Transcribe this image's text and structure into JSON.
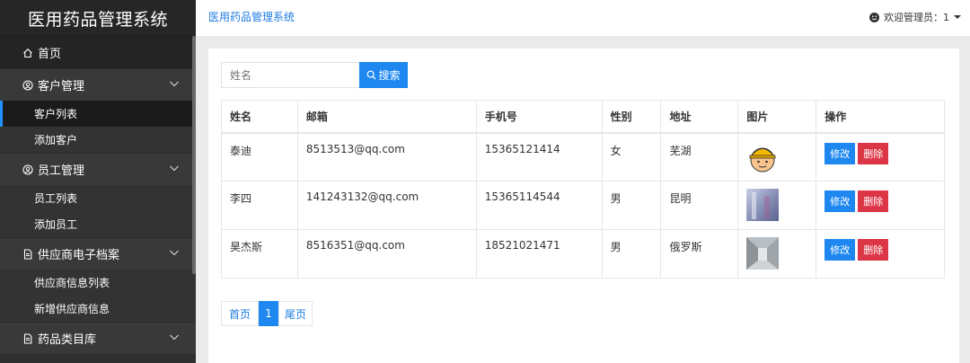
{
  "app": {
    "title": "医用药品管理系统"
  },
  "header": {
    "link": "医用药品管理系统",
    "welcome": "欢迎管理员：1"
  },
  "sidebar": {
    "home": "首页",
    "groups": [
      {
        "label": "客户管理",
        "icon": "user-circle-icon",
        "items": [
          "客户列表",
          "添加客户"
        ]
      },
      {
        "label": "员工管理",
        "icon": "user-circle-icon",
        "items": [
          "员工列表",
          "添加员工"
        ]
      },
      {
        "label": "供应商电子档案",
        "icon": "document-icon",
        "items": [
          "供应商信息列表",
          "新增供应商信息"
        ]
      },
      {
        "label": "药品类目库",
        "icon": "document-icon",
        "items": []
      }
    ],
    "active_item": "客户列表"
  },
  "search": {
    "placeholder": "姓名",
    "button": "搜索"
  },
  "table": {
    "columns": [
      "姓名",
      "邮箱",
      "手机号",
      "性别",
      "地址",
      "图片",
      "操作"
    ],
    "rows": [
      {
        "name": "泰迪",
        "email": "8513513@qq.com",
        "phone": "15365121414",
        "gender": "女",
        "address": "芜湖",
        "image": "cartoon-worker-avatar"
      },
      {
        "name": "李四",
        "email": "141243132@qq.com",
        "phone": "15365114544",
        "gender": "男",
        "address": "昆明",
        "image": "blurry-photo"
      },
      {
        "name": "昊杰斯",
        "email": "8516351@qq.com",
        "phone": "18521021471",
        "gender": "男",
        "address": "俄罗斯",
        "image": "corridor-photo"
      }
    ],
    "edit_label": "修改",
    "delete_label": "删除"
  },
  "pager": {
    "first": "首页",
    "current": "1",
    "last": "尾页"
  },
  "colors": {
    "primary": "#1e88f0",
    "danger": "#dc3545",
    "sidebar": "#2f2f2f"
  }
}
